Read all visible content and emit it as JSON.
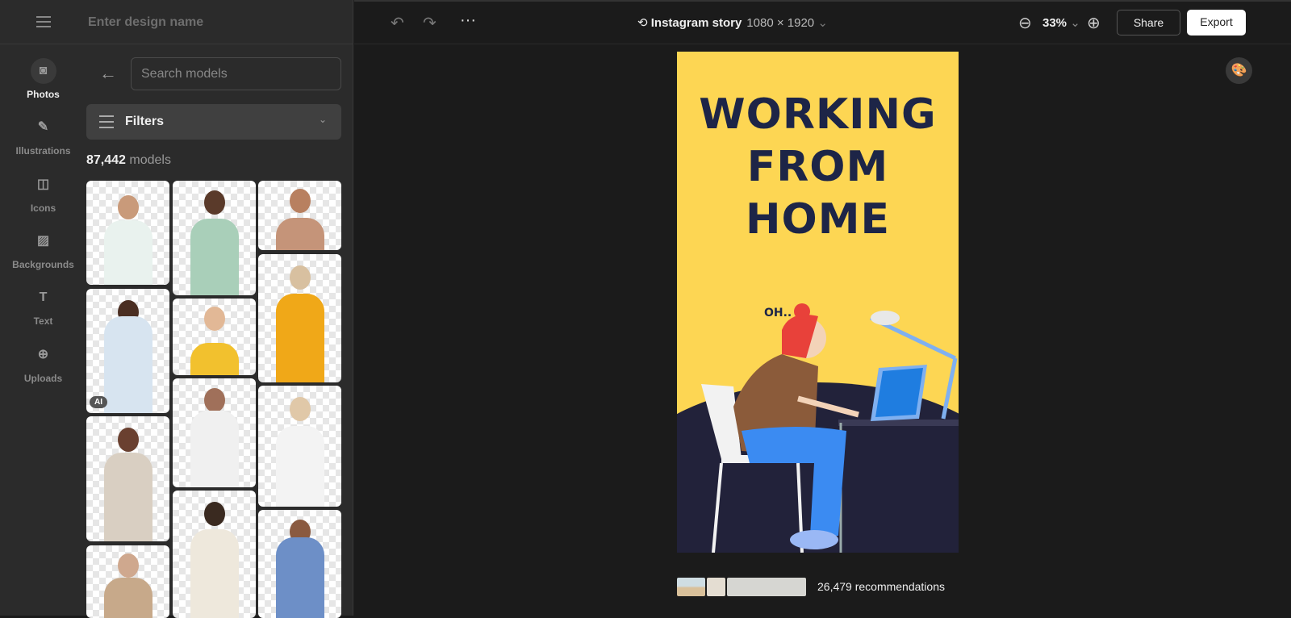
{
  "sidebar": {
    "design_name_placeholder": "Enter design name",
    "rail": [
      {
        "label": "Photos",
        "icon": "camera-icon",
        "active": true
      },
      {
        "label": "Illustrations",
        "icon": "pen-nib-icon"
      },
      {
        "label": "Icons",
        "icon": "shapes-icon"
      },
      {
        "label": "Backgrounds",
        "icon": "image-icon"
      },
      {
        "label": "Text",
        "icon": "text-icon"
      },
      {
        "label": "Uploads",
        "icon": "plus-circle-icon"
      }
    ],
    "search_placeholder": "Search models",
    "filters_label": "Filters",
    "count_number": "87,442",
    "count_label": "models",
    "ai_badge": "AI"
  },
  "topbar": {
    "title": "Instagram story",
    "dimensions": "1080 × 1920",
    "zoom": "33%",
    "share": "Share",
    "export": "Export"
  },
  "design": {
    "line1": "WORKING",
    "line2": "FROM",
    "line3": "HOME",
    "bubble": "OH..",
    "colors": {
      "background": "#fdd653",
      "text": "#1d2547"
    }
  },
  "recommendations": "26,479 recommendations"
}
